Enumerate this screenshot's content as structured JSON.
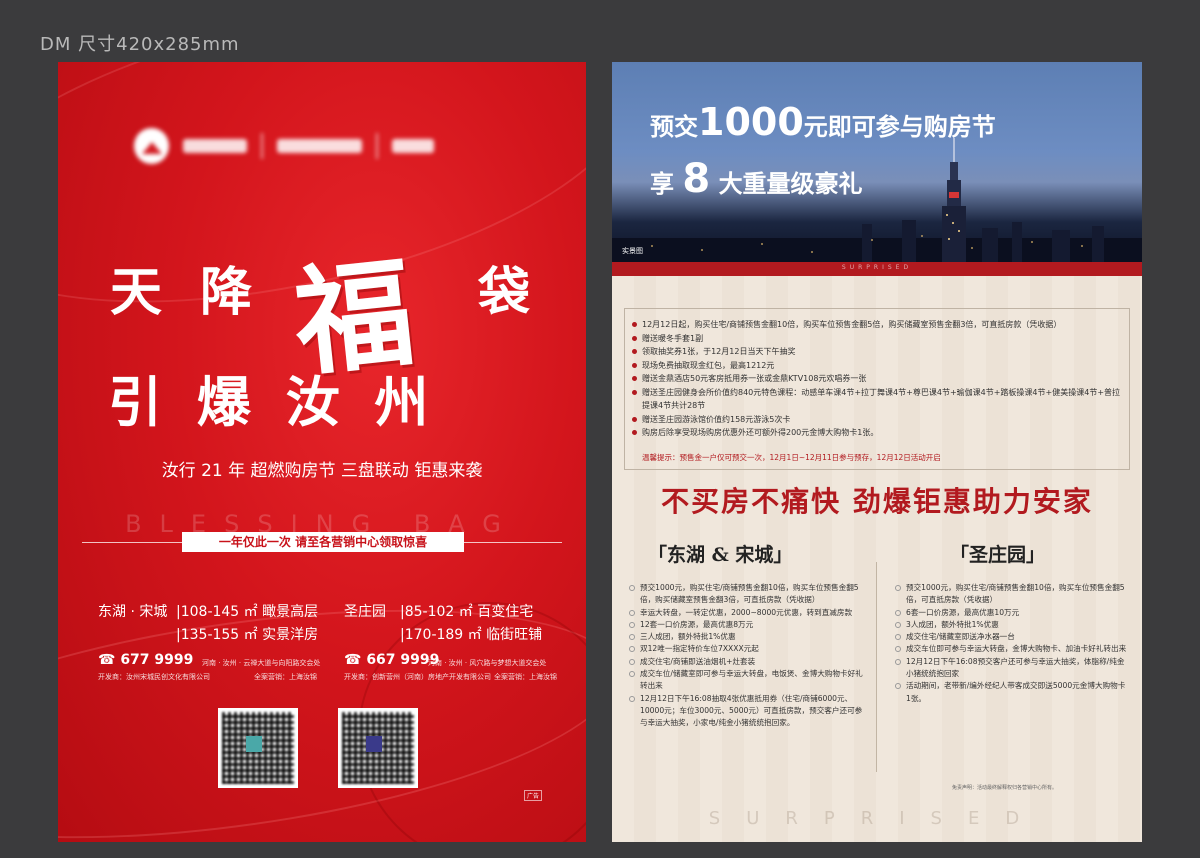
{
  "dm_label": "DM 尺寸420x285mm",
  "left": {
    "headline1": {
      "c1": "天",
      "c2": "降",
      "c3": "袋"
    },
    "fu": "福",
    "headline2": "引 爆 汝 州",
    "subline": "汝行 21 年  超燃购房节  三盘联动  钜惠来袭",
    "bless": "BLESSING BAG",
    "pill": "一年仅此一次 请至各营销中心领取惊喜",
    "projects": {
      "a_name": "东湖 · 宋城",
      "a_l1": "|108-145 ㎡ 瞰景高层",
      "a_l2": "|135-155 ㎡ 实景洋房",
      "b_name": "圣庄园",
      "b_l1": "|85-102 ㎡ 百变住宅",
      "b_l2": "|170-189 ㎡ 临街旺铺"
    },
    "phone1": "677 9999",
    "addr1": "河南 · 汝州 · 云禅大道与向阳路交会处",
    "dev1": "开发商：汝州宋城民创文化有限公司",
    "agent1": "全案营销：上海汝锦",
    "phone2": "667 9999",
    "addr2": "河南 · 汝州 · 风穴路与梦想大道交会处",
    "dev2": "开发商：创新营州（河南）房地产开发有限公司",
    "agent2": "全案营销：上海汝锦",
    "ad_tag": "广告"
  },
  "right": {
    "t1_a": "预交",
    "t1_big": "1000",
    "t1_b": "元即可参与购房节",
    "t2_a": "享",
    "t2_big": "8",
    "t2_b": "大重量级豪礼",
    "banner_tag": "实景图",
    "surprised": "SURPRISED",
    "info": [
      "12月12日起，购买住宅/商铺预售金翻10倍，购买车位预售金翻5倍，购买储藏室预售金翻3倍，可直抵房款（凭收据）",
      "赠送暖冬手套1副",
      "领取抽奖券1张，于12月12日当天下午抽奖",
      "现场免费抽取现金红包，最高1212元",
      "赠送金鼎酒店50元客房抵用券一张或金鼎KTV108元欢唱券一张",
      "赠送圣庄园健身会所价值约840元特色课程：动感单车课4节+拉丁舞课4节+尊巴课4节+瑜伽课4节+踏板操课4节+健美操课4节+普拉提课4节共计28节",
      "赠送圣庄园游泳馆价值约158元游泳5次卡",
      "购房后除享受现场购房优惠外还可额外得200元金博大购物卡1张。"
    ],
    "tip": "温馨提示：预售金一户仅可预交一次，12月1日~12月11日参与预存，12月12日活动开启",
    "slogan": "不买房不痛快  劲爆钜惠助力安家",
    "col1_title": "「东湖 & 宋城」",
    "col1": [
      "预交1000元，购买住宅/商铺预售金翻10倍，购买车位预售金翻5倍，购买储藏室预售金翻3倍，可直抵房款（凭收据）",
      "幸运大转盘，一转定优惠，2000~8000元优惠，转到直减房款",
      "12套一口价房源，最高优惠8万元",
      "三人成团，额外特批1%优惠",
      "双12唯一指定特价车位7XXXX元起",
      "成交住宅/商铺即送油烟机+灶套装",
      "成交车位/储藏室即可参与幸运大转盘，电饭煲、金博大购物卡好礼转出来",
      "12月12日下午16:08抽取4张优惠抵用券（住宅/商铺6000元、10000元；车位3000元、5000元）可直抵房款，预交客户还可参与幸运大抽奖，小家电/纯金小猪统统抱回家。"
    ],
    "col2_title": "「圣庄园」",
    "col2": [
      "预交1000元，购买住宅/商铺预售金翻10倍，购买车位预售金翻5倍，可直抵房款（凭收据）",
      "6套一口价房源，最高优惠10万元",
      "3人成团，额外特批1%优惠",
      "成交住宅/储藏室即送净水器一台",
      "成交车位即可参与幸运大转盘，金博大购物卡、加油卡好礼转出来",
      "12月12日下午16:08预交客户还可参与幸运大抽奖，体脂称/纯金小猪统统抱回家",
      "活动期间，老带新/编外经纪人带客成交即送5000元金博大购物卡1张。"
    ],
    "disclaimer": "免责声明：活动最终解释权归各营销中心所有。",
    "surprised2": "SURPRISED"
  }
}
